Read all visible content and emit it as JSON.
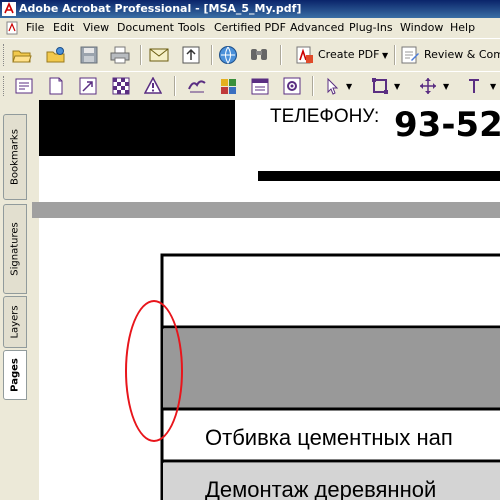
{
  "window": {
    "title": "Adobe Acrobat Professional - [MSA_5_My.pdf]"
  },
  "menu": [
    "File",
    "Edit",
    "View",
    "Document",
    "Tools",
    "Certified PDF",
    "Advanced",
    "Plug-Ins",
    "Window",
    "Help"
  ],
  "toolbar": {
    "create_pdf": "Create PDF",
    "review": "Review & Comm"
  },
  "nav_tabs": [
    "Bookmarks",
    "Signatures",
    "Layers",
    "Pages"
  ],
  "document": {
    "phone_label": "ТЕЛЕФОНУ:",
    "phone_number": "93-52",
    "row1": "Отбивка цементных нап",
    "row2": "Демонтаж деревянной"
  },
  "colors": {
    "annotation": "#e8151b",
    "title_bar": "#0a246a",
    "gray_band": "#a0a0a0"
  }
}
